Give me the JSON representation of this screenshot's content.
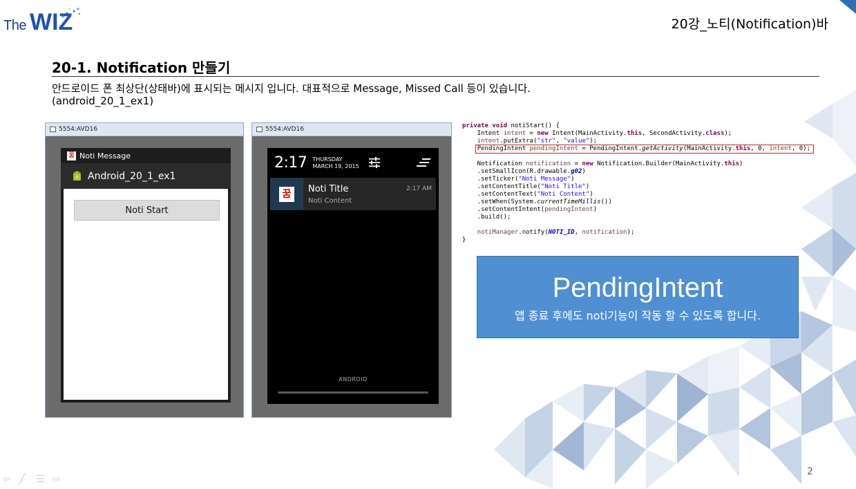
{
  "header": {
    "logo_the": "The",
    "logo_wiz": "WIZ",
    "title": "20강_노티(Notification)바"
  },
  "section": {
    "title": "20-1. Notification 만들기",
    "desc_line1": "안드로이드 폰 최상단(상태바)에 표시되는 메시지 입니다. 대표적으로 Message, Missed Call 등이 있습니다.",
    "desc_line2": "(android_20_1_ex1)"
  },
  "emulator1": {
    "window_title": "5554:AVD16",
    "notification_label": "Noti Message",
    "app_name": "Android_20_1_ex1",
    "button_label": "Noti Start",
    "app_icon_glyph": "꿈"
  },
  "emulator2": {
    "window_title": "5554:AVD16",
    "time": "2:17",
    "day": "THURSDAY",
    "date": "MARCH 19, 2015",
    "noti_title": "Noti Title",
    "noti_content": "Noti Content",
    "noti_time": "2:17 AM",
    "footer_label": "ANDROID",
    "app_icon_glyph": "꿈"
  },
  "code": {
    "l1_kw1": "private",
    "l1_kw2": "void",
    "l1_rest": " notiStart() {",
    "l2_a": "    Intent ",
    "l2_var": "intent",
    "l2_b": " = ",
    "l2_kw": "new",
    "l2_c": " Intent(MainActivity.",
    "l2_kw2": "this",
    "l2_d": ", SecondActivity.",
    "l2_kw3": "class",
    "l2_e": ");",
    "l3_var": "    intent",
    "l3_a": ".putExtra(",
    "l3_s1": "\"str\"",
    "l3_b": ", ",
    "l3_s2": "\"value\"",
    "l3_c": ");",
    "l4_a": "PendingIntent ",
    "l4_var": "pendingIntent",
    "l4_b": " = PendingIntent.",
    "l4_it": "getActivity",
    "l4_c": "(MainActivity.",
    "l4_kw": "this",
    "l4_d": ", 0, ",
    "l4_var2": "intent",
    "l4_e": ", 0);",
    "l6_a": "    Notification ",
    "l6_var": "notification",
    "l6_b": " = ",
    "l6_kw": "new",
    "l6_c": " Notification.Builder(MainActivity.",
    "l6_kw2": "this",
    "l6_d": ")",
    "l7_a": "    .setSmallIcon(R.drawable.",
    "l7_bi": "g02",
    "l7_b": ")",
    "l8_a": "    .setTicker(",
    "l8_s": "\"Noti Message\"",
    "l8_b": ")",
    "l9_a": "    .setContentTitle(",
    "l9_s": "\"Noti Title\"",
    "l9_b": ")",
    "l10_a": "    .setContentText(",
    "l10_s": "\"Noti Content\"",
    "l10_b": ")",
    "l11_a": "    .setWhen(System.",
    "l11_it": "currentTimeMillis",
    "l11_b": "())",
    "l12_a": "    .setContentIntent(",
    "l12_var": "pendingIntent",
    "l12_b": ")",
    "l13": "    .build();",
    "l15_var": "    notiManager",
    "l15_a": ".notify(",
    "l15_bi": "NOTI_ID",
    "l15_b": ", ",
    "l15_var2": "notification",
    "l15_c": ");",
    "l16": "}"
  },
  "callout": {
    "title": "PendingIntent",
    "subtitle": "앱 종료 후에도 noti기능이 작동 할 수 있도록 합니다."
  },
  "footer": {
    "page_number": "2"
  },
  "colors": {
    "accent": "#2f6fb2",
    "callout_bg": "#4f8fd2",
    "deco_light": "#e3eaf4",
    "deco_mid": "#c5d3e7",
    "deco_dark": "#9fb4d4"
  }
}
